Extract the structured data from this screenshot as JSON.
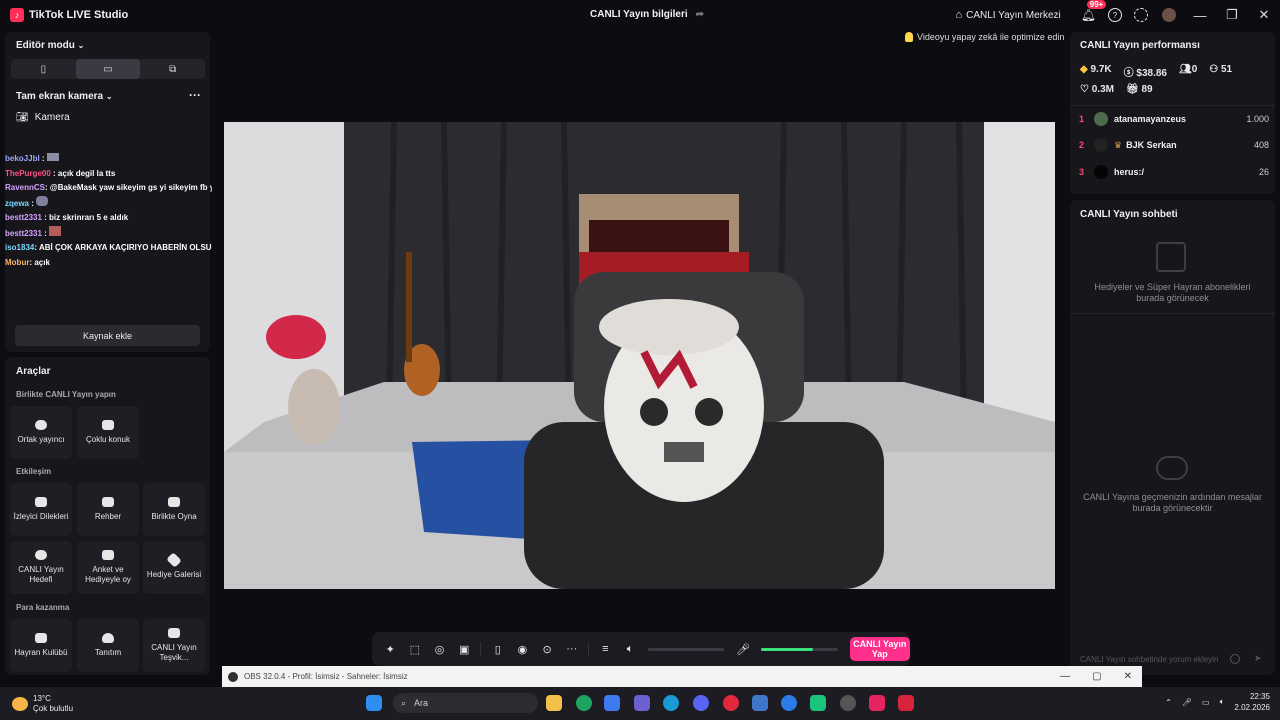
{
  "app": {
    "title": "TikTok LIVE Studio",
    "center_title": "CANLI Yayın bilgileri",
    "hub_label": "CANLI Yayın Merkezi",
    "notif_badge": "99+"
  },
  "left": {
    "editor_mode": "Editör modu",
    "scene_label": "Tam ekran kamera",
    "camera_label": "Kamera",
    "add_source": "Kaynak ekle",
    "chat": [
      {
        "user": "bekoJJbl",
        "msg": ":"
      },
      {
        "user": "ThePurge00",
        "msg": ": açık degil la tts"
      },
      {
        "user": "RavennCS",
        "msg": ": @BakeMask yaw sikeyim gs yi sikeyim fb yi yeter mağmağ yaw"
      },
      {
        "user": "zqewa",
        "msg": ":"
      },
      {
        "user": "bestt2331",
        "msg": ": biz skrinrarı 5 e aldık"
      },
      {
        "user": "bestt2331",
        "msg": ":"
      },
      {
        "user": "iso1834",
        "msg": ": ABİ ÇOK ARKAYA KAÇIRIYO HABERİN OLSUNN @bakemask"
      },
      {
        "user": "Mobur",
        "msg": ": açık"
      }
    ]
  },
  "tools": {
    "title": "Araçlar",
    "sec1": "Birlikte CANLI Yayın yapın",
    "sec2": "Etkileşim",
    "sec3": "Para kazanma",
    "t1": "Ortak yayıncı",
    "t2": "Çoklu konuk",
    "t3": "İzleyici Dilekleri",
    "t4": "Rehber",
    "t5": "Birlikte Oyna",
    "t6": "CANLI Yayın Hedefi",
    "t7": "Anket ve Hediyeyle oy",
    "t8": "Hediye Galerisi",
    "t9": "Hayran Kulübü",
    "t10": "Tanıtım",
    "t11": "CANLI Yayın Teşvik..."
  },
  "preview": {
    "optimize": "Videoyu yapay zekâ ile optimize edin"
  },
  "toolbar": {
    "go_live": "CANLI Yayın Yap",
    "mic_level": 0.68
  },
  "right": {
    "perf_title": "CANLI Yayın performansı",
    "diamonds": "9.7K",
    "earnings": "$38.86",
    "viewers": "0",
    "followers": "51",
    "likes": "0.3M",
    "gifts": "89",
    "ranks": [
      {
        "n": "1",
        "name": "atanamayanzeus",
        "score": "1.000"
      },
      {
        "n": "2",
        "name": "BJK Serkan",
        "score": "408"
      },
      {
        "n": "3",
        "name": "herus:/",
        "score": "26"
      }
    ],
    "chat_title": "CANLI Yayın sohbeti",
    "gifts_empty": "Hediyeler ve Süper Hayran abonelikleri burada görünecek",
    "chat_empty": "CANLI Yayına geçmenizin ardından mesajlar burada görünecektir",
    "chat_placeholder": "CANLI Yayın sohbetinde yorum ekleyin"
  },
  "obs": {
    "title": "OBS 32.0.4 - Profil: İsimsiz - Sahneler: İsimsiz"
  },
  "taskbar": {
    "temp": "13°C",
    "weather": "Çok bulutlu",
    "search": "Ara",
    "time": "22:35",
    "date": "2.02.2026"
  }
}
